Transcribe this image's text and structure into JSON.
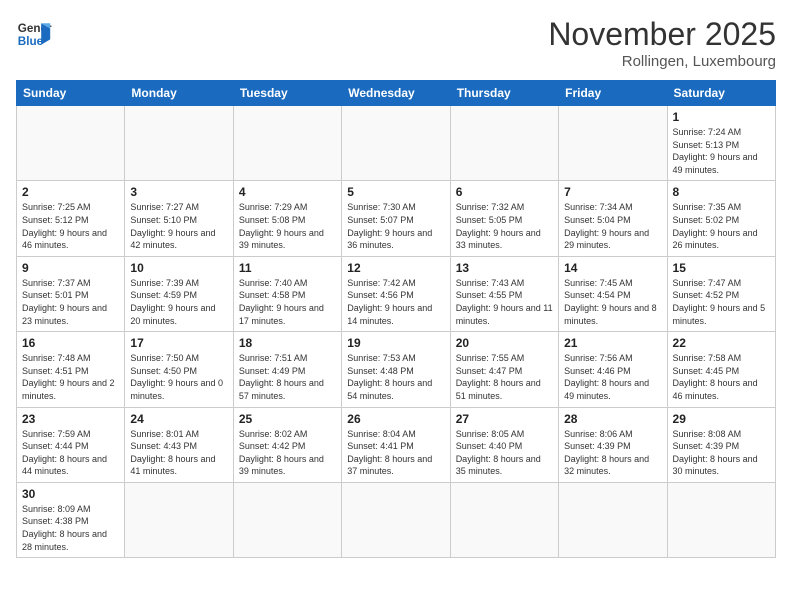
{
  "header": {
    "logo_general": "General",
    "logo_blue": "Blue",
    "month_title": "November 2025",
    "subtitle": "Rollingen, Luxembourg"
  },
  "weekdays": [
    "Sunday",
    "Monday",
    "Tuesday",
    "Wednesday",
    "Thursday",
    "Friday",
    "Saturday"
  ],
  "weeks": [
    [
      {
        "day": "",
        "info": ""
      },
      {
        "day": "",
        "info": ""
      },
      {
        "day": "",
        "info": ""
      },
      {
        "day": "",
        "info": ""
      },
      {
        "day": "",
        "info": ""
      },
      {
        "day": "",
        "info": ""
      },
      {
        "day": "1",
        "info": "Sunrise: 7:24 AM\nSunset: 5:13 PM\nDaylight: 9 hours and 49 minutes."
      }
    ],
    [
      {
        "day": "2",
        "info": "Sunrise: 7:25 AM\nSunset: 5:12 PM\nDaylight: 9 hours and 46 minutes."
      },
      {
        "day": "3",
        "info": "Sunrise: 7:27 AM\nSunset: 5:10 PM\nDaylight: 9 hours and 42 minutes."
      },
      {
        "day": "4",
        "info": "Sunrise: 7:29 AM\nSunset: 5:08 PM\nDaylight: 9 hours and 39 minutes."
      },
      {
        "day": "5",
        "info": "Sunrise: 7:30 AM\nSunset: 5:07 PM\nDaylight: 9 hours and 36 minutes."
      },
      {
        "day": "6",
        "info": "Sunrise: 7:32 AM\nSunset: 5:05 PM\nDaylight: 9 hours and 33 minutes."
      },
      {
        "day": "7",
        "info": "Sunrise: 7:34 AM\nSunset: 5:04 PM\nDaylight: 9 hours and 29 minutes."
      },
      {
        "day": "8",
        "info": "Sunrise: 7:35 AM\nSunset: 5:02 PM\nDaylight: 9 hours and 26 minutes."
      }
    ],
    [
      {
        "day": "9",
        "info": "Sunrise: 7:37 AM\nSunset: 5:01 PM\nDaylight: 9 hours and 23 minutes."
      },
      {
        "day": "10",
        "info": "Sunrise: 7:39 AM\nSunset: 4:59 PM\nDaylight: 9 hours and 20 minutes."
      },
      {
        "day": "11",
        "info": "Sunrise: 7:40 AM\nSunset: 4:58 PM\nDaylight: 9 hours and 17 minutes."
      },
      {
        "day": "12",
        "info": "Sunrise: 7:42 AM\nSunset: 4:56 PM\nDaylight: 9 hours and 14 minutes."
      },
      {
        "day": "13",
        "info": "Sunrise: 7:43 AM\nSunset: 4:55 PM\nDaylight: 9 hours and 11 minutes."
      },
      {
        "day": "14",
        "info": "Sunrise: 7:45 AM\nSunset: 4:54 PM\nDaylight: 9 hours and 8 minutes."
      },
      {
        "day": "15",
        "info": "Sunrise: 7:47 AM\nSunset: 4:52 PM\nDaylight: 9 hours and 5 minutes."
      }
    ],
    [
      {
        "day": "16",
        "info": "Sunrise: 7:48 AM\nSunset: 4:51 PM\nDaylight: 9 hours and 2 minutes."
      },
      {
        "day": "17",
        "info": "Sunrise: 7:50 AM\nSunset: 4:50 PM\nDaylight: 9 hours and 0 minutes."
      },
      {
        "day": "18",
        "info": "Sunrise: 7:51 AM\nSunset: 4:49 PM\nDaylight: 8 hours and 57 minutes."
      },
      {
        "day": "19",
        "info": "Sunrise: 7:53 AM\nSunset: 4:48 PM\nDaylight: 8 hours and 54 minutes."
      },
      {
        "day": "20",
        "info": "Sunrise: 7:55 AM\nSunset: 4:47 PM\nDaylight: 8 hours and 51 minutes."
      },
      {
        "day": "21",
        "info": "Sunrise: 7:56 AM\nSunset: 4:46 PM\nDaylight: 8 hours and 49 minutes."
      },
      {
        "day": "22",
        "info": "Sunrise: 7:58 AM\nSunset: 4:45 PM\nDaylight: 8 hours and 46 minutes."
      }
    ],
    [
      {
        "day": "23",
        "info": "Sunrise: 7:59 AM\nSunset: 4:44 PM\nDaylight: 8 hours and 44 minutes."
      },
      {
        "day": "24",
        "info": "Sunrise: 8:01 AM\nSunset: 4:43 PM\nDaylight: 8 hours and 41 minutes."
      },
      {
        "day": "25",
        "info": "Sunrise: 8:02 AM\nSunset: 4:42 PM\nDaylight: 8 hours and 39 minutes."
      },
      {
        "day": "26",
        "info": "Sunrise: 8:04 AM\nSunset: 4:41 PM\nDaylight: 8 hours and 37 minutes."
      },
      {
        "day": "27",
        "info": "Sunrise: 8:05 AM\nSunset: 4:40 PM\nDaylight: 8 hours and 35 minutes."
      },
      {
        "day": "28",
        "info": "Sunrise: 8:06 AM\nSunset: 4:39 PM\nDaylight: 8 hours and 32 minutes."
      },
      {
        "day": "29",
        "info": "Sunrise: 8:08 AM\nSunset: 4:39 PM\nDaylight: 8 hours and 30 minutes."
      }
    ],
    [
      {
        "day": "30",
        "info": "Sunrise: 8:09 AM\nSunset: 4:38 PM\nDaylight: 8 hours and 28 minutes."
      },
      {
        "day": "",
        "info": ""
      },
      {
        "day": "",
        "info": ""
      },
      {
        "day": "",
        "info": ""
      },
      {
        "day": "",
        "info": ""
      },
      {
        "day": "",
        "info": ""
      },
      {
        "day": "",
        "info": ""
      }
    ]
  ]
}
